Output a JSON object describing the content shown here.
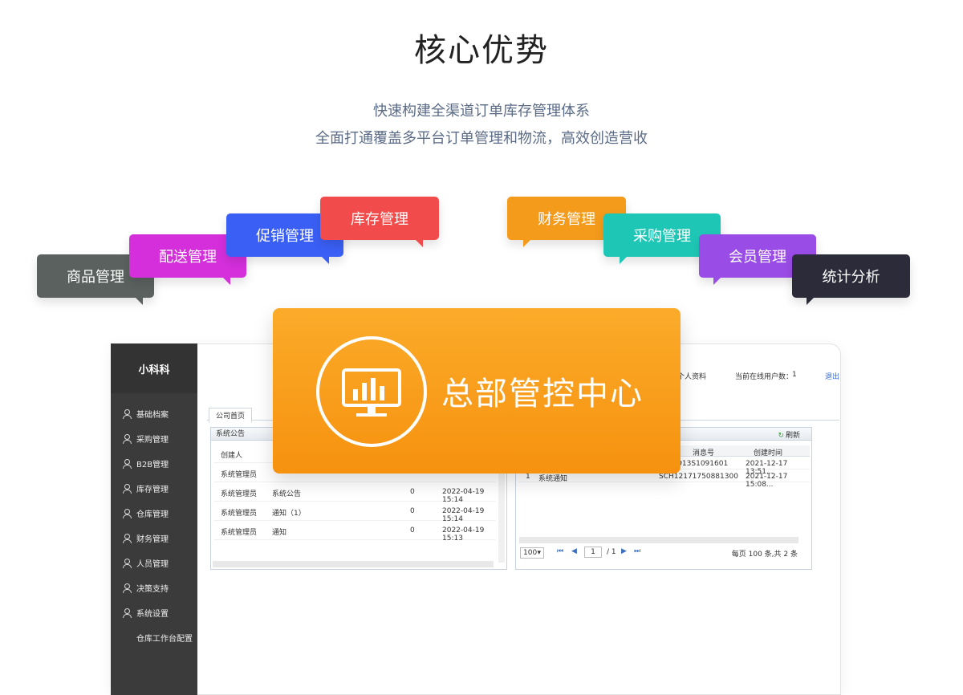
{
  "header": {
    "title": "核心优势",
    "subtitle_line1": "快速构建全渠道订单库存管理体系",
    "subtitle_line2": "全面打通覆盖多平台订单管理和物流，高效创造营收"
  },
  "bubbles": [
    {
      "label": "商品管理",
      "color": "#5a615f"
    },
    {
      "label": "配送管理",
      "color": "#d42fdb"
    },
    {
      "label": "促销管理",
      "color": "#3a5ff5"
    },
    {
      "label": "库存管理",
      "color": "#f24b4b"
    },
    {
      "label": "财务管理",
      "color": "#f49b1b"
    },
    {
      "label": "采购管理",
      "color": "#1ec7b5"
    },
    {
      "label": "会员管理",
      "color": "#9a4ce6"
    },
    {
      "label": "统计分析",
      "color": "#2b2b3a"
    }
  ],
  "center": {
    "label": "总部管控中心",
    "icon": "monitor-chart-icon"
  },
  "app": {
    "brand": "小科科",
    "sidebar": [
      {
        "label": "基础档案"
      },
      {
        "label": "采购管理"
      },
      {
        "label": "B2B管理"
      },
      {
        "label": "库存管理"
      },
      {
        "label": "仓库管理"
      },
      {
        "label": "财务管理"
      },
      {
        "label": "人员管理"
      },
      {
        "label": "决策支持"
      },
      {
        "label": "系统设置"
      },
      {
        "label": "仓库工作台配置"
      }
    ],
    "topbar": {
      "profile": "个人资料",
      "online_label": "当前在线用户数：",
      "online_count": "1",
      "logout": "退出"
    },
    "tab": "公司首页",
    "notice": {
      "title": "系统公告",
      "col_creator": "创建人",
      "rows": [
        {
          "creator": "系统管理员",
          "title": "系统公告",
          "count": "0",
          "time": "2022-04-19 15:14"
        },
        {
          "creator": "系统管理员",
          "title": "通知（1）",
          "count": "0",
          "time": "2022-04-19 15:14"
        },
        {
          "creator": "系统管理员",
          "title": "通知",
          "count": "0",
          "time": "2022-04-19 15:13"
        }
      ]
    },
    "messages": {
      "refresh": "刷新",
      "col_msgno": "消息号",
      "col_created": "创建时间",
      "rows": [
        {
          "msgno": "D13S1091601",
          "created": "2021-12-17 13:51..."
        },
        {
          "no": "1",
          "type": "系统通知",
          "msgno": "SCH12171750881300",
          "created": "2021-12-17 15:08..."
        }
      ],
      "pager": {
        "size": "100",
        "page": "1",
        "total_pages": "/ 1",
        "summary": "每页 100 条,共 2 条"
      }
    }
  }
}
